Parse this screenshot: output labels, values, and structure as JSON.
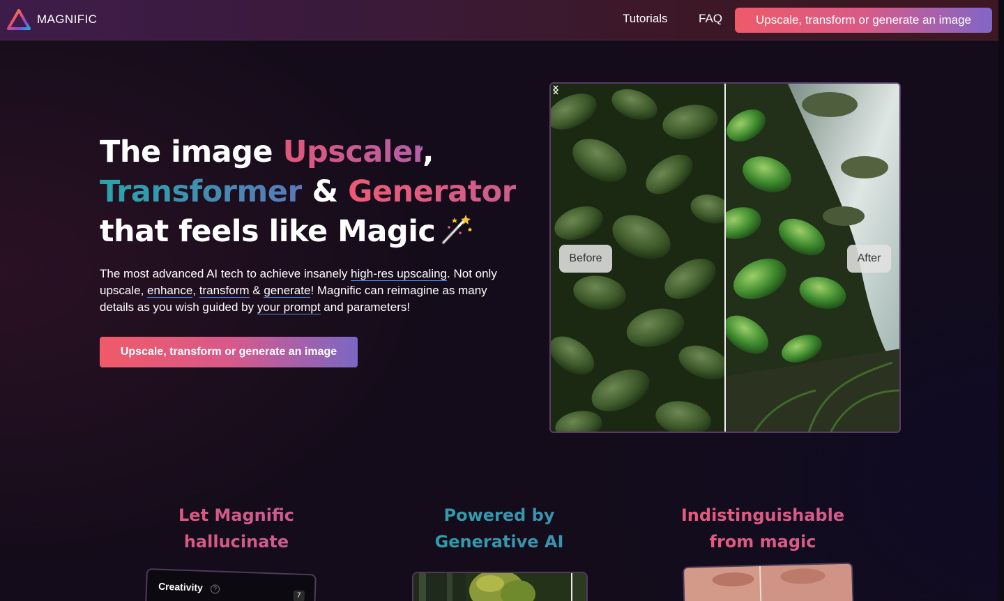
{
  "nav": {
    "brand": "MAGNIFIC",
    "links": [
      "Tutorials",
      "FAQ"
    ],
    "cta_label": "Upscale, transform or generate an image"
  },
  "hero": {
    "title": {
      "l1_a": "The image ",
      "l1_b": "Upscaler",
      "l1_c": ",",
      "l2_a": "Transformer",
      "l2_b": " & ",
      "l2_c": "Generator",
      "l3": "that feels like Magic"
    },
    "description": {
      "p1": "The most advanced AI tech to achieve insanely ",
      "link1": "high-res upscaling",
      "p2": ". Not only upscale, ",
      "link2": "enhance",
      "p3": ", ",
      "link3": "transform",
      "p4": " & ",
      "link4": "generate",
      "p5": "! Magnific can reimagine as many details as you wish guided by ",
      "link5": "your prompt",
      "p6": " and parameters!"
    },
    "cta_label": "Upscale, transform or generate an image"
  },
  "compare": {
    "before_label": "Before",
    "after_label": "After"
  },
  "features": [
    {
      "line1": "Let Magnific",
      "line2": "hallucinate"
    },
    {
      "line1": "Powered by",
      "line2": "Generative AI"
    },
    {
      "line1": "Indistinguishable",
      "line2": "from magic"
    }
  ],
  "creativity_card": {
    "label": "Creativity",
    "info": "?",
    "value": "7"
  },
  "colors": {
    "accent_pink": "#e2577a",
    "accent_teal": "#27a5a8",
    "accent_purple": "#7b67c4",
    "background": "#140c1a"
  }
}
